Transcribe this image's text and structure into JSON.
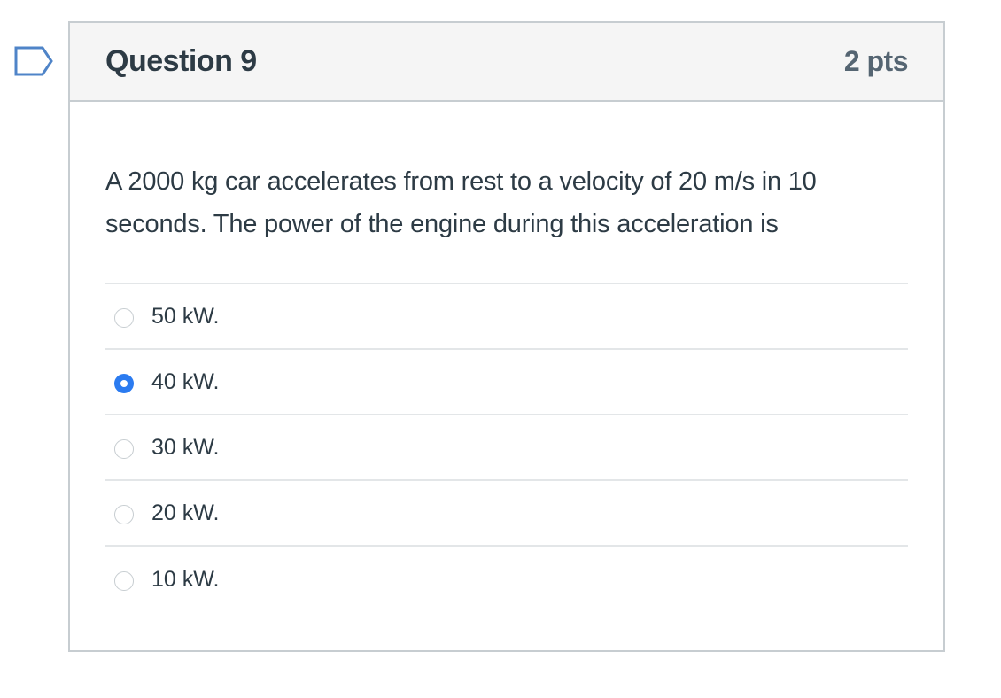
{
  "question": {
    "title": "Question 9",
    "points": "2 pts",
    "text": "A 2000 kg car accelerates from rest to a velocity of 20 m/s in 10 seconds. The power of the engine during this acceleration is",
    "flag_icon": "bookmark-flag-icon"
  },
  "answers": [
    {
      "label": "50 kW.",
      "selected": false
    },
    {
      "label": "40 kW.",
      "selected": true
    },
    {
      "label": "30 kW.",
      "selected": false
    },
    {
      "label": "20 kW.",
      "selected": false
    },
    {
      "label": "10 kW.",
      "selected": false
    }
  ],
  "colors": {
    "accent": "#2b7bf0",
    "header_bg": "#f5f5f5",
    "border": "#c7cdd1",
    "text": "#2d3b45",
    "points_text": "#556572"
  }
}
